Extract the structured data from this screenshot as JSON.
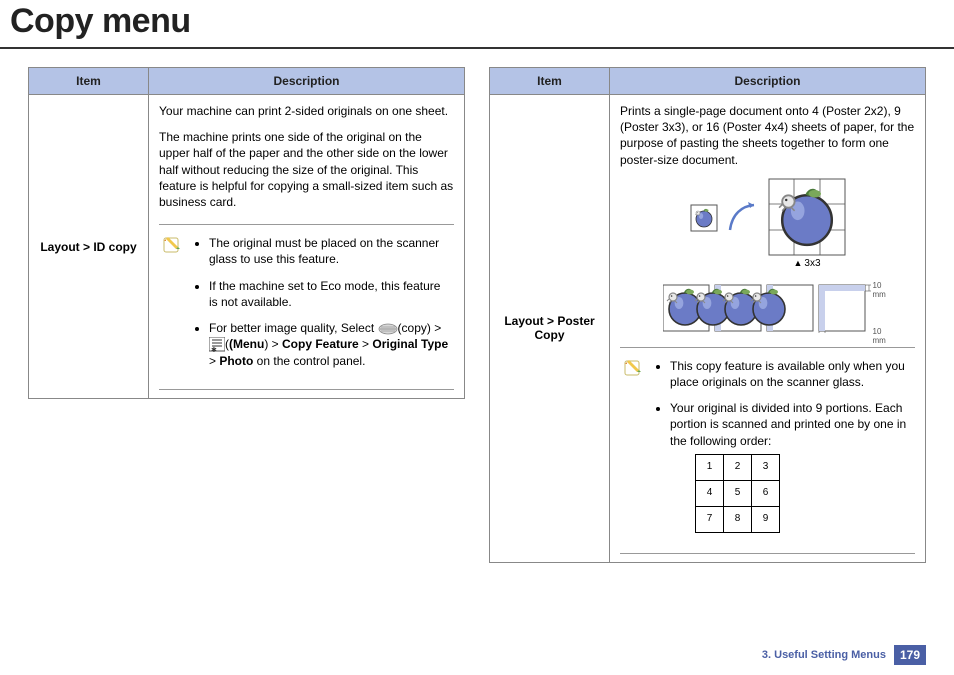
{
  "page_title": "Copy menu",
  "headers": {
    "item": "Item",
    "description": "Description"
  },
  "left": {
    "item_label": "Layout > ID copy",
    "p1": "Your machine can print 2-sided originals on one sheet.",
    "p2": "The machine prints one side of the original on the upper half of the paper and the other side on the lower half without reducing the size of the original. This feature is helpful for copying a small-sized item such as business card.",
    "note1": "The original must be placed on the scanner glass to use this feature.",
    "note2": "If the machine set to Eco mode, this feature is not available.",
    "note3_pre": "For better image quality, Select ",
    "note3_copy": "(copy)",
    "note3_gt1": " > ",
    "note3_menu": "(Menu",
    "note3_menu2": ") > ",
    "note3_cf": "Copy Feature",
    "note3_gt2": " > ",
    "note3_ot": "Original Type",
    "note3_gt3": " > ",
    "note3_photo": "Photo",
    "note3_end": " on the control panel."
  },
  "right": {
    "item_label": "Layout > Poster Copy",
    "p1": "Prints a single-page document onto 4 (Poster 2x2), 9 (Poster 3x3), or 16 (Poster 4x4) sheets of paper, for the purpose of pasting the sheets together to form one poster-size document.",
    "caption_3x3": "3x3",
    "overlap_a": "10 mm",
    "overlap_b": "10 mm",
    "note1": "This copy feature is available only when you place originals on the scanner glass.",
    "note2": "Your original is divided into 9 portions. Each portion is scanned and printed one by one in the following order:",
    "order": [
      "1",
      "2",
      "3",
      "4",
      "5",
      "6",
      "7",
      "8",
      "9"
    ]
  },
  "footer": {
    "section": "3.  Useful Setting Menus",
    "page": "179"
  }
}
